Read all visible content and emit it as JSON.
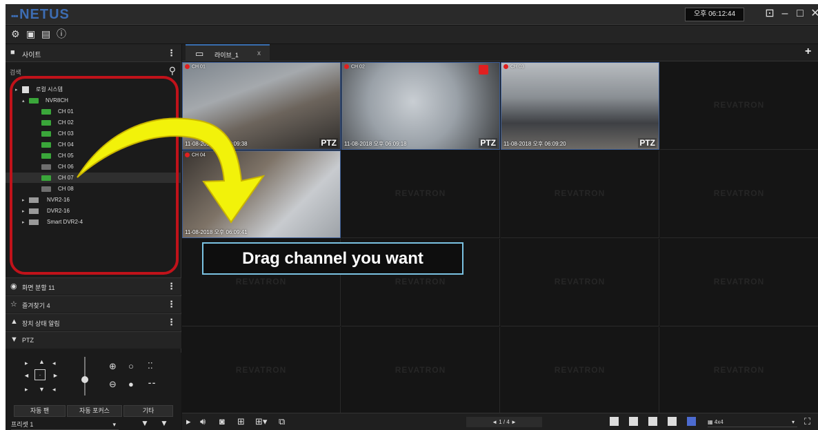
{
  "app": {
    "title": "NETUS",
    "clock": "오후 06:12:44",
    "window_buttons": [
      "⊡",
      "–",
      "□",
      "✕"
    ]
  },
  "toolbar": {
    "icons": [
      "gear-icon",
      "calendar-icon",
      "list-icon",
      "info-icon"
    ]
  },
  "sidebar": {
    "site_header": "사이트",
    "search_label": "검색",
    "tree": [
      {
        "label": "로컬 시스템",
        "kind": "root"
      },
      {
        "label": "NVR8CH",
        "kind": "group"
      },
      {
        "label": "CH 01",
        "kind": "cam",
        "on": true
      },
      {
        "label": "CH 02",
        "kind": "cam",
        "on": true
      },
      {
        "label": "CH 03",
        "kind": "cam",
        "on": true
      },
      {
        "label": "CH 04",
        "kind": "cam",
        "on": true
      },
      {
        "label": "CH 05",
        "kind": "cam",
        "on": true
      },
      {
        "label": "CH 06",
        "kind": "cam",
        "on": false
      },
      {
        "label": "CH 07",
        "kind": "cam",
        "on": true,
        "selected": true
      },
      {
        "label": "CH 08",
        "kind": "cam",
        "on": false
      },
      {
        "label": "NVR2-16",
        "kind": "device"
      },
      {
        "label": "DVR2-16",
        "kind": "device"
      },
      {
        "label": "Smart DVR2-4",
        "kind": "device"
      }
    ],
    "panels": [
      {
        "label": "화면 분할 11",
        "icon": "eye-icon"
      },
      {
        "label": "즐겨찾기 4",
        "icon": "star-icon"
      },
      {
        "label": "장치 상태 알림",
        "icon": "alert-icon"
      },
      {
        "label": "PTZ",
        "icon": "ptz-camera-icon"
      }
    ],
    "ptz": {
      "auto_focus_btn1": "자동 팬",
      "auto_focus_btn2": "자동 포커스",
      "other_btn": "기타",
      "preset": "프리셋 1"
    }
  },
  "main": {
    "tab_label": "라이브_1",
    "tab_close": "x",
    "add_tab": "+",
    "watermark": "REVATRON",
    "videos": [
      {
        "top": "CH 01",
        "stamp": "11-08-2018 오후 06:09:38",
        "ptz": "PTZ"
      },
      {
        "top": "CH 02",
        "stamp": "11-08-2018 오후 06:09:18",
        "ptz": "PTZ"
      },
      {
        "top": "CH 03",
        "stamp": "11-08-2018 오후 06:09:20",
        "ptz": "PTZ"
      },
      {
        "top": "CH 04",
        "stamp": "11-08-2018 오후 06:09:41",
        "ptz": ""
      }
    ],
    "callout": "Drag channel you want",
    "pager": "◄  1  /  4  ►",
    "layout_select": "▦ 4x4"
  }
}
